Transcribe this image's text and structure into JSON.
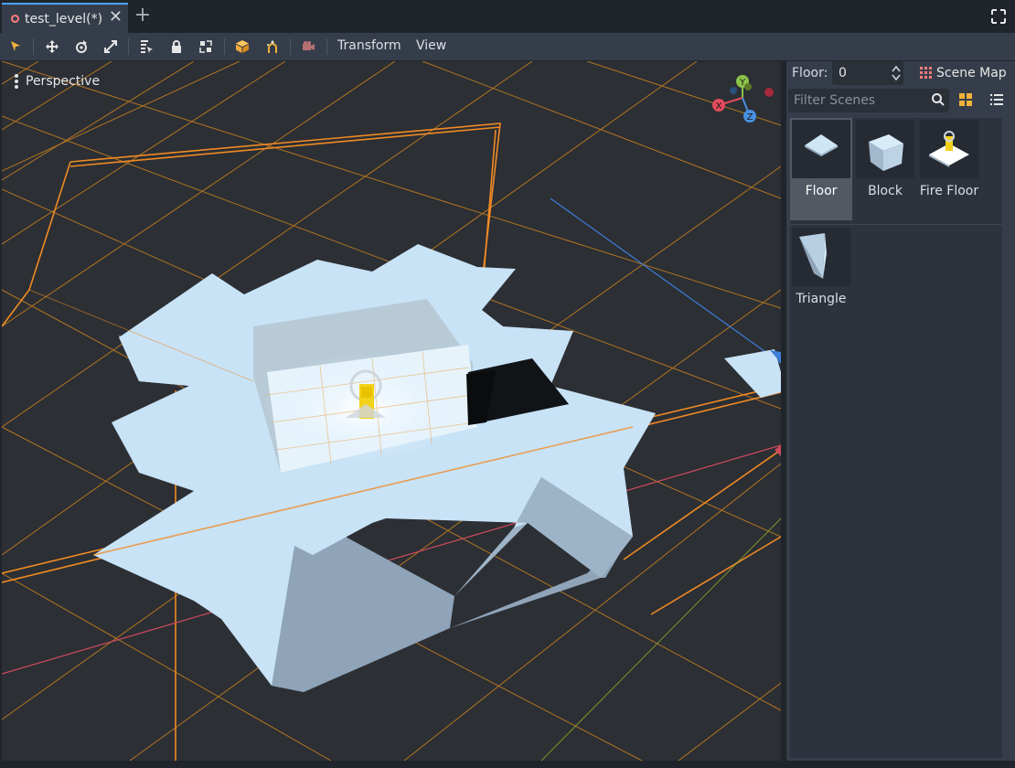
{
  "tab": {
    "title": "test_level(*)",
    "close": "✕",
    "add": "+"
  },
  "toolbar": {
    "icons": [
      "select-icon",
      "move-icon",
      "rotate-icon",
      "scale-icon",
      "list-select-icon",
      "lock-icon",
      "group-icon",
      "snap-icon",
      "local-space-icon",
      "camera-icon"
    ],
    "menus": {
      "transform": "Transform",
      "view": "View"
    }
  },
  "viewport": {
    "mode_label": "Perspective",
    "gizmo": {
      "x": "X",
      "y": "Y",
      "z": "Z"
    }
  },
  "gridmap": {
    "floor_label": "Floor:",
    "floor_value": "0",
    "scene_map_label": "Scene Map",
    "filter_placeholder": "Filter Scenes",
    "items": [
      {
        "label": "Floor",
        "selected": true
      },
      {
        "label": "Block",
        "selected": false
      },
      {
        "label": "Fire Floor",
        "selected": false
      },
      {
        "label": "Triangle",
        "selected": false
      }
    ]
  },
  "colors": {
    "accent": "#47a3ff",
    "grid": "#e08a1e",
    "mesh": "#c8e2f6",
    "panel": "#363d4a",
    "viewport_bg": "#2c2f34"
  }
}
